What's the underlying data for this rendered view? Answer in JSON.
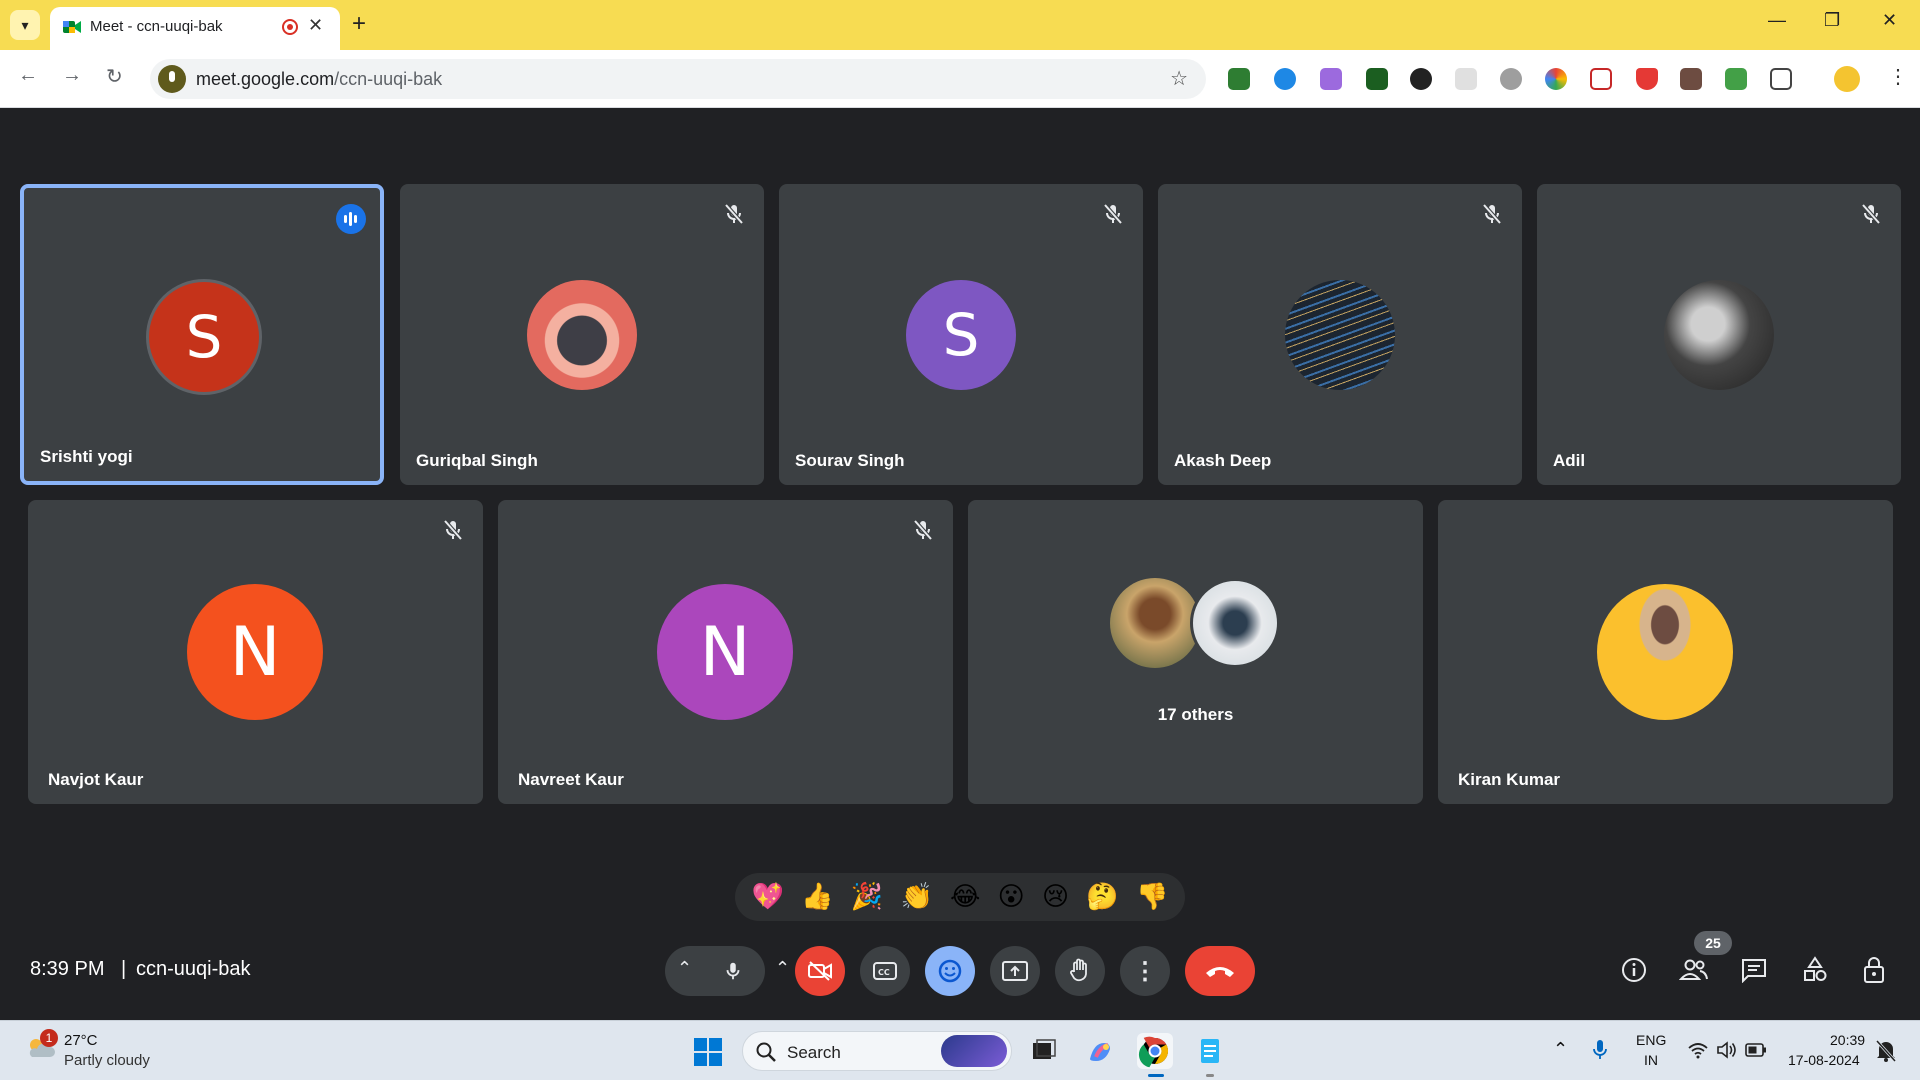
{
  "browser": {
    "tab": {
      "title": "Meet - ccn-uuqi-bak",
      "close": "✕"
    },
    "new_tab": "+",
    "window_controls": {
      "minimize": "—",
      "restore": "❐",
      "close": "✕"
    },
    "url": {
      "host": "meet.google.com",
      "path": "/ccn-uuqi-bak"
    },
    "theme_color": "#f7dc52"
  },
  "meeting": {
    "time": "8:39 PM",
    "separator": "|",
    "code": "ccn-uuqi-bak",
    "participant_count": "25",
    "participants_row1": [
      {
        "name": "Srishti yogi",
        "initial": "S",
        "avatar_color": "#c5331a",
        "speaking": true,
        "muted": false
      },
      {
        "name": "Guriqbal Singh",
        "initial": "",
        "avatar_color": "#e36a5f",
        "muted": true,
        "avatar_kind": "photo"
      },
      {
        "name": "Sourav Singh",
        "initial": "S",
        "avatar_color": "#7e57c2",
        "muted": true
      },
      {
        "name": "Akash Deep",
        "initial": "",
        "avatar_color": "#1c2530",
        "muted": true,
        "avatar_kind": "photo"
      },
      {
        "name": "Adil",
        "initial": "",
        "avatar_color": "#555555",
        "muted": true,
        "avatar_kind": "photo"
      }
    ],
    "participants_row2": [
      {
        "name": "Navjot Kaur",
        "initial": "N",
        "avatar_color": "#f4511e",
        "muted": true
      },
      {
        "name": "Navreet Kaur",
        "initial": "N",
        "avatar_color": "#ab47bc",
        "muted": true
      },
      {
        "name": "17 others",
        "kind": "others"
      },
      {
        "name": "Kiran Kumar",
        "initial": "",
        "avatar_color": "#fbc02d",
        "muted": false,
        "avatar_kind": "photo"
      }
    ],
    "reactions": [
      "💖",
      "👍",
      "🎉",
      "👏",
      "😂",
      "😮",
      "😢",
      "🤔",
      "👎"
    ],
    "controls": [
      "mic-options",
      "mic",
      "camera-options",
      "camera-off",
      "captions",
      "emoji",
      "present",
      "raise-hand",
      "more",
      "leave-call"
    ],
    "right_controls": [
      "info",
      "people",
      "chat",
      "activities",
      "host-controls"
    ],
    "accent_blue": "#8ab4f8",
    "leave_red": "#ea4335"
  },
  "taskbar": {
    "weather": {
      "badge": "1",
      "temp": "27°C",
      "condition": "Partly cloudy"
    },
    "search_placeholder": "Search",
    "lang": {
      "line1": "ENG",
      "line2": "IN"
    },
    "clock": {
      "time": "20:39",
      "date": "17-08-2024"
    }
  }
}
